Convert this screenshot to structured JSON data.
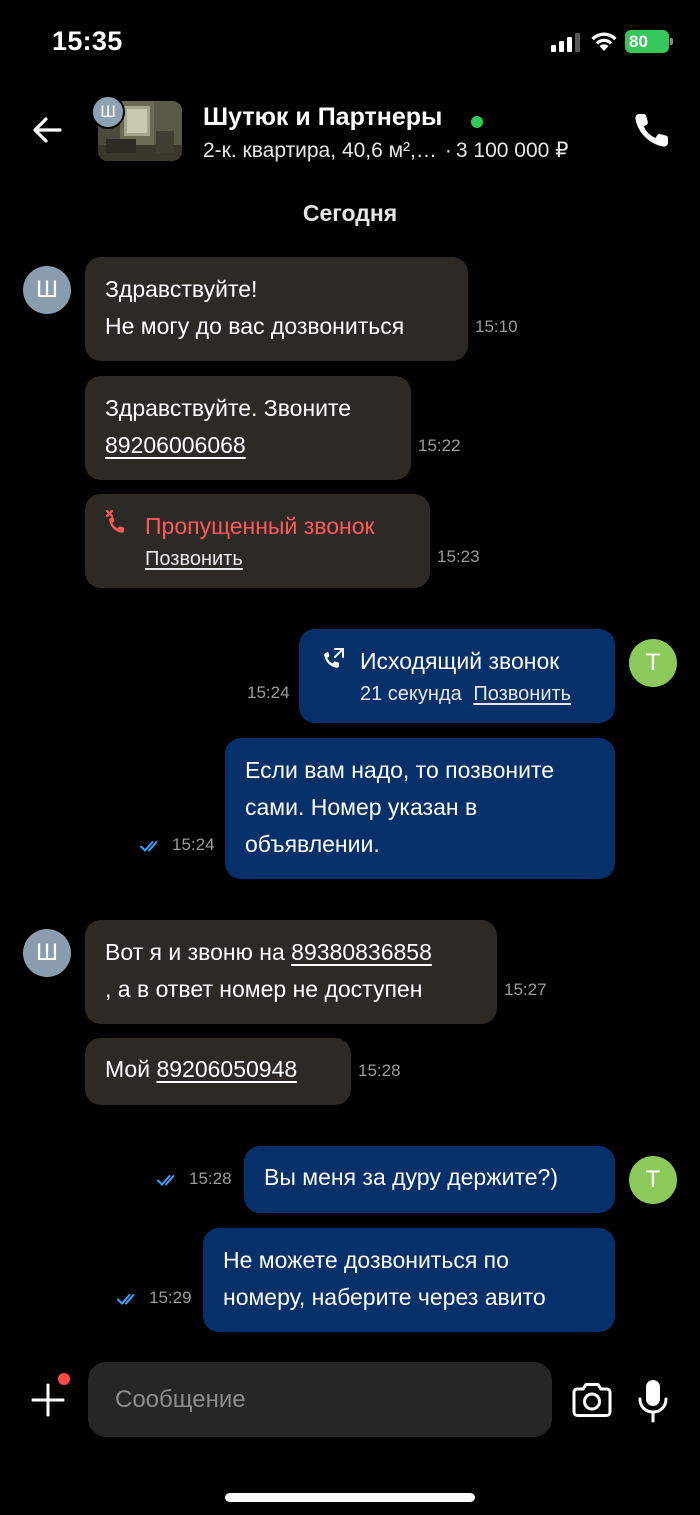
{
  "status_bar": {
    "time": "15:35",
    "battery": "80"
  },
  "header": {
    "avatar_letter": "Ш",
    "name": "Шутюк и Партнеры",
    "listing": "2-к. квартира, 40,6 м²,…",
    "price": "3 100 000 ₽"
  },
  "date_separator": "Сегодня",
  "messages": {
    "m1": {
      "line1": "Здравствуйте!",
      "line2": "Не могу до вас дозвониться",
      "time": "15:10",
      "avatar": "Ш"
    },
    "m2": {
      "text": "Здравствуйте. Звоните",
      "phone": "89206006068",
      "time": "15:22"
    },
    "m3": {
      "title": "Пропущенный звонок",
      "link": "Позвонить",
      "time": "15:23"
    },
    "m4": {
      "title": "Исходящий звонок",
      "duration": "21 секунда",
      "link": "Позвонить",
      "time": "15:24",
      "avatar": "Т"
    },
    "m5": {
      "line1": "Если вам надо, то позвоните",
      "line2": "сами. Номер указан в",
      "line3": "объявлении.",
      "time": "15:24"
    },
    "m6": {
      "prefix": "Вот я и звоню на",
      "phone": "89380836858",
      "line2": ", а в ответ номер не доступен",
      "time": "15:27",
      "avatar": "Ш"
    },
    "m7": {
      "prefix": "Мой",
      "phone": "89206050948",
      "time": "15:28"
    },
    "m8": {
      "text": "Вы меня за дуру держите?)",
      "time": "15:28",
      "avatar": "Т"
    },
    "m9": {
      "line1": "Не можете дозвониться по",
      "line2": "номеру, наберите через авито",
      "time": "15:29"
    }
  },
  "composer": {
    "placeholder": "Сообщение"
  },
  "colors": {
    "incoming": "#2d2a25",
    "outgoing": "#05306a",
    "read_check": "#3aa3ff",
    "missed": "#ff5a5a",
    "online": "#2ecc53"
  }
}
